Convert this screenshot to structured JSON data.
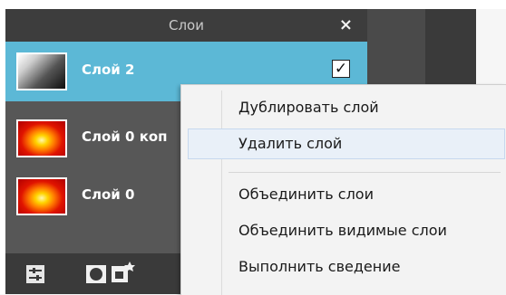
{
  "panel": {
    "title": "Слои",
    "close_glyph": "×"
  },
  "layers": [
    {
      "name": "Слой 2",
      "thumbnail": "gray-gradient",
      "selected": true,
      "visible_checked": true,
      "check_glyph": "✓"
    },
    {
      "name": "Слой 0 коп",
      "thumbnail": "fire"
    },
    {
      "name": "Слой 0",
      "thumbnail": "fire"
    }
  ],
  "footer_icons": [
    "layer-settings-icon",
    "layer-mask-icon",
    "new-layer-icon"
  ],
  "context_menu": {
    "items": [
      {
        "label": "Дублировать слой"
      },
      {
        "label": "Удалить слой",
        "highlighted": true
      },
      {
        "label": "Объединить слои"
      },
      {
        "label": "Объединить видимые слои"
      },
      {
        "label": "Выполнить сведение"
      }
    ]
  },
  "colors": {
    "panel_bg": "#575757",
    "header_bg": "#3d3d3d",
    "selected_row": "#5cb8d6",
    "menu_bg": "#f3f3f3",
    "menu_hover": "#e9f0f8"
  }
}
